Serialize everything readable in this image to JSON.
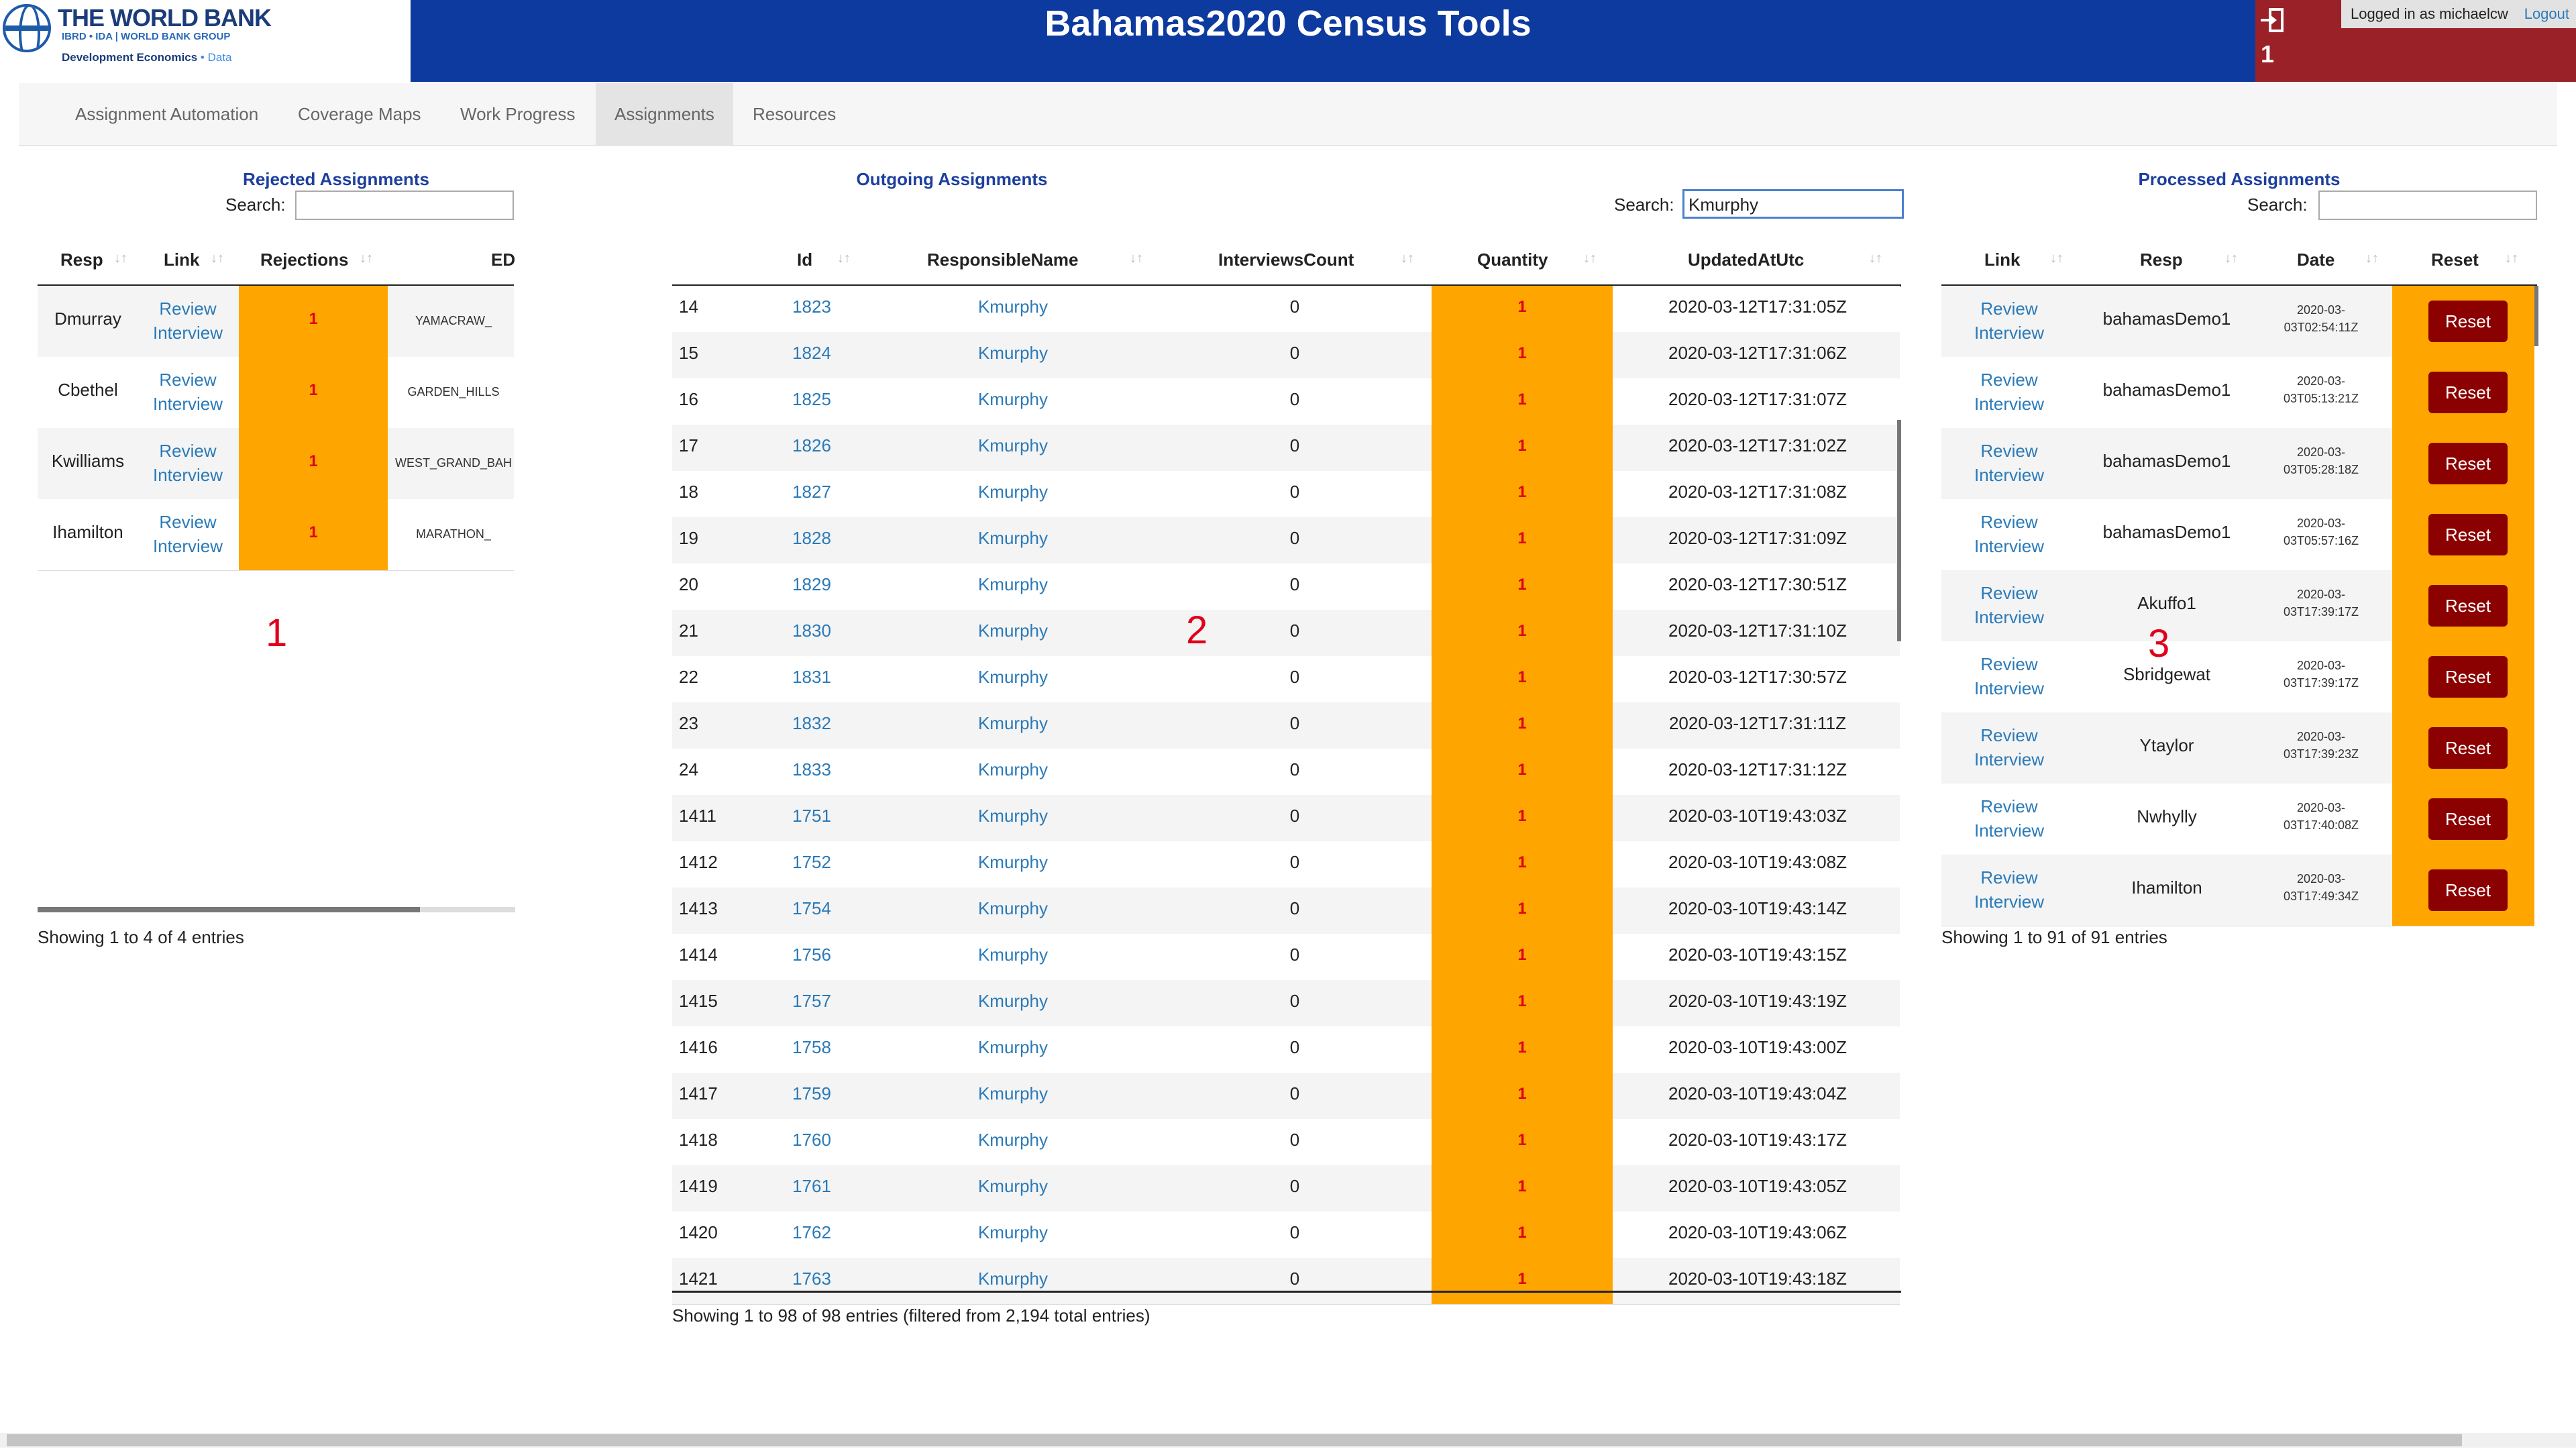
{
  "header": {
    "logo_title": "THE WORLD BANK",
    "logo_subtitle": "IBRD • IDA | WORLD BANK GROUP",
    "logo_dev": "Development Economics",
    "logo_dev_data": "• Data",
    "app_title": "Bahamas2020 Census Tools",
    "notif_count": "1",
    "logged_in": "Logged in as michaelcw",
    "logout": "Logout"
  },
  "nav": {
    "tabs": [
      "Assignment Automation",
      "Coverage Maps",
      "Work Progress",
      "Assignments",
      "Resources"
    ],
    "active": "Assignments"
  },
  "rejected": {
    "title": "Rejected Assignments",
    "search_label": "Search:",
    "search_value": "",
    "columns": [
      "Resp",
      "Link",
      "Rejections",
      "ED"
    ],
    "rows": [
      {
        "resp": "Dmurray",
        "link": "Review Interview",
        "rejections": "1",
        "ed": "YAMACRAW_"
      },
      {
        "resp": "Cbethel",
        "link": "Review Interview",
        "rejections": "1",
        "ed": "GARDEN_HILLS"
      },
      {
        "resp": "Kwilliams",
        "link": "Review Interview",
        "rejections": "1",
        "ed": "WEST_GRAND_BAH"
      },
      {
        "resp": "Ihamilton",
        "link": "Review Interview",
        "rejections": "1",
        "ed": "MARATHON_"
      }
    ],
    "footer": "Showing 1 to 4 of 4 entries"
  },
  "outgoing": {
    "title": "Outgoing Assignments",
    "search_label": "Search:",
    "search_value": "Kmurphy",
    "columns": [
      "Id",
      "ResponsibleName",
      "InterviewsCount",
      "Quantity",
      "UpdatedAtUtc"
    ],
    "rows": [
      {
        "n": "14",
        "id": "1823",
        "resp": "Kmurphy",
        "count": "0",
        "qty": "1",
        "updated": "2020-03-12T17:31:05Z"
      },
      {
        "n": "15",
        "id": "1824",
        "resp": "Kmurphy",
        "count": "0",
        "qty": "1",
        "updated": "2020-03-12T17:31:06Z"
      },
      {
        "n": "16",
        "id": "1825",
        "resp": "Kmurphy",
        "count": "0",
        "qty": "1",
        "updated": "2020-03-12T17:31:07Z"
      },
      {
        "n": "17",
        "id": "1826",
        "resp": "Kmurphy",
        "count": "0",
        "qty": "1",
        "updated": "2020-03-12T17:31:02Z"
      },
      {
        "n": "18",
        "id": "1827",
        "resp": "Kmurphy",
        "count": "0",
        "qty": "1",
        "updated": "2020-03-12T17:31:08Z"
      },
      {
        "n": "19",
        "id": "1828",
        "resp": "Kmurphy",
        "count": "0",
        "qty": "1",
        "updated": "2020-03-12T17:31:09Z"
      },
      {
        "n": "20",
        "id": "1829",
        "resp": "Kmurphy",
        "count": "0",
        "qty": "1",
        "updated": "2020-03-12T17:30:51Z"
      },
      {
        "n": "21",
        "id": "1830",
        "resp": "Kmurphy",
        "count": "0",
        "qty": "1",
        "updated": "2020-03-12T17:31:10Z"
      },
      {
        "n": "22",
        "id": "1831",
        "resp": "Kmurphy",
        "count": "0",
        "qty": "1",
        "updated": "2020-03-12T17:30:57Z"
      },
      {
        "n": "23",
        "id": "1832",
        "resp": "Kmurphy",
        "count": "0",
        "qty": "1",
        "updated": "2020-03-12T17:31:11Z"
      },
      {
        "n": "24",
        "id": "1833",
        "resp": "Kmurphy",
        "count": "0",
        "qty": "1",
        "updated": "2020-03-12T17:31:12Z"
      },
      {
        "n": "1411",
        "id": "1751",
        "resp": "Kmurphy",
        "count": "0",
        "qty": "1",
        "updated": "2020-03-10T19:43:03Z"
      },
      {
        "n": "1412",
        "id": "1752",
        "resp": "Kmurphy",
        "count": "0",
        "qty": "1",
        "updated": "2020-03-10T19:43:08Z"
      },
      {
        "n": "1413",
        "id": "1754",
        "resp": "Kmurphy",
        "count": "0",
        "qty": "1",
        "updated": "2020-03-10T19:43:14Z"
      },
      {
        "n": "1414",
        "id": "1756",
        "resp": "Kmurphy",
        "count": "0",
        "qty": "1",
        "updated": "2020-03-10T19:43:15Z"
      },
      {
        "n": "1415",
        "id": "1757",
        "resp": "Kmurphy",
        "count": "0",
        "qty": "1",
        "updated": "2020-03-10T19:43:19Z"
      },
      {
        "n": "1416",
        "id": "1758",
        "resp": "Kmurphy",
        "count": "0",
        "qty": "1",
        "updated": "2020-03-10T19:43:00Z"
      },
      {
        "n": "1417",
        "id": "1759",
        "resp": "Kmurphy",
        "count": "0",
        "qty": "1",
        "updated": "2020-03-10T19:43:04Z"
      },
      {
        "n": "1418",
        "id": "1760",
        "resp": "Kmurphy",
        "count": "0",
        "qty": "1",
        "updated": "2020-03-10T19:43:17Z"
      },
      {
        "n": "1419",
        "id": "1761",
        "resp": "Kmurphy",
        "count": "0",
        "qty": "1",
        "updated": "2020-03-10T19:43:05Z"
      },
      {
        "n": "1420",
        "id": "1762",
        "resp": "Kmurphy",
        "count": "0",
        "qty": "1",
        "updated": "2020-03-10T19:43:06Z"
      },
      {
        "n": "1421",
        "id": "1763",
        "resp": "Kmurphy",
        "count": "0",
        "qty": "1",
        "updated": "2020-03-10T19:43:18Z"
      }
    ],
    "footer": "Showing 1 to 98 of 98 entries (filtered from 2,194 total entries)"
  },
  "processed": {
    "title": "Processed Assignments",
    "search_label": "Search:",
    "search_value": "",
    "columns": [
      "Link",
      "Resp",
      "Date",
      "Reset"
    ],
    "rows": [
      {
        "link": "Review Interview",
        "resp": "bahamasDemo1",
        "date1": "2020-03-",
        "date2": "03T02:54:11Z",
        "btn": "Reset"
      },
      {
        "link": "Review Interview",
        "resp": "bahamasDemo1",
        "date1": "2020-03-",
        "date2": "03T05:13:21Z",
        "btn": "Reset"
      },
      {
        "link": "Review Interview",
        "resp": "bahamasDemo1",
        "date1": "2020-03-",
        "date2": "03T05:28:18Z",
        "btn": "Reset"
      },
      {
        "link": "Review Interview",
        "resp": "bahamasDemo1",
        "date1": "2020-03-",
        "date2": "03T05:57:16Z",
        "btn": "Reset"
      },
      {
        "link": "Review Interview",
        "resp": "Akuffo1",
        "date1": "2020-03-",
        "date2": "03T17:39:17Z",
        "btn": "Reset"
      },
      {
        "link": "Review Interview",
        "resp": "Sbridgewat",
        "date1": "2020-03-",
        "date2": "03T17:39:17Z",
        "btn": "Reset"
      },
      {
        "link": "Review Interview",
        "resp": "Ytaylor",
        "date1": "2020-03-",
        "date2": "03T17:39:23Z",
        "btn": "Reset"
      },
      {
        "link": "Review Interview",
        "resp": "Nwhylly",
        "date1": "2020-03-",
        "date2": "03T17:40:08Z",
        "btn": "Reset"
      },
      {
        "link": "Review Interview",
        "resp": "Ihamilton",
        "date1": "2020-03-",
        "date2": "03T17:49:34Z",
        "btn": "Reset"
      }
    ],
    "footer": "Showing 1 to 91 of 91 entries"
  },
  "markers": [
    "1",
    "2",
    "3"
  ],
  "colors": {
    "header_bg": "#0d3a9e",
    "accent_red": "#9b2128",
    "highlight": "#ffa500",
    "reset_btn": "#8b0000",
    "link": "#2a7ab8"
  }
}
